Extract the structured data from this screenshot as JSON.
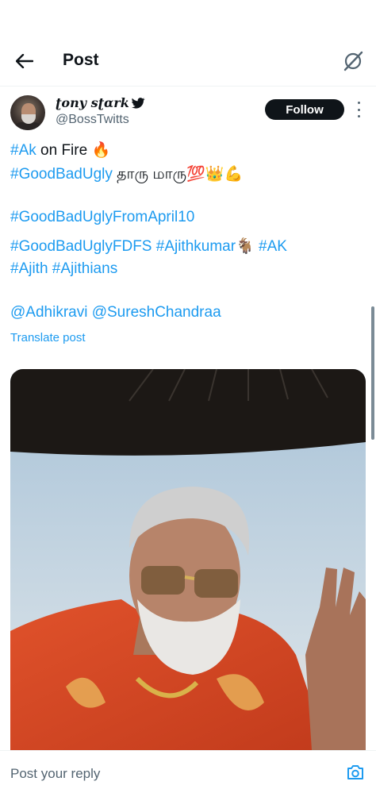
{
  "header": {
    "title": "Post"
  },
  "post": {
    "author_name": "ʈony sʈɑrk",
    "author_handle": "@BossTwitts",
    "follow_label": "Follow",
    "lines": [
      {
        "tag": "#Ak",
        "rest": " on Fire 🔥"
      },
      {
        "tag": "#GoodBadUgly",
        "rest": " தாரு மாரு💯👑💪"
      },
      {
        "tag": "#GoodBadUglyFromApril10",
        "rest": ""
      },
      {
        "tag": "#GoodBadUglyFDFS #Ajithkumar",
        "rest": "🐐",
        "tag2": " #AK"
      },
      {
        "tag": "#Ajith #Ajithians",
        "rest": ""
      },
      {
        "tag": "@Adhikravi @SureshChandraa",
        "rest": ""
      }
    ],
    "translate_label": "Translate post"
  },
  "reply": {
    "placeholder": "Post your reply"
  },
  "colors": {
    "link": "#1d9bf0",
    "text": "#0f1419",
    "muted": "#536471",
    "button": "#0f1419"
  },
  "icons": [
    "back-arrow-icon",
    "grok-icon",
    "verified-bird-icon",
    "more-icon",
    "camera-icon"
  ]
}
